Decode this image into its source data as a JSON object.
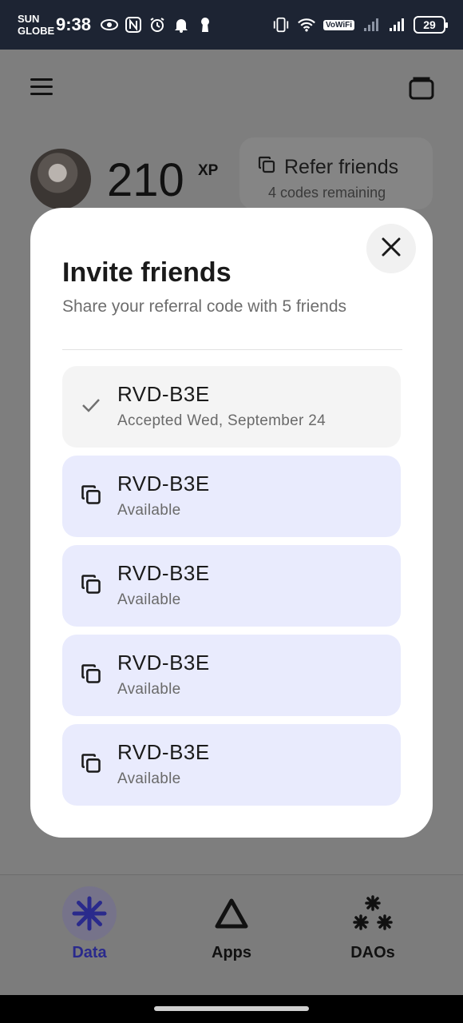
{
  "status_bar": {
    "carrier_line1": "SUN",
    "carrier_line2": "GLOBE",
    "time": "9:38",
    "vowifi": "VoWiFi",
    "battery": "29",
    "left_icons": [
      "eye-icon",
      "nfc-icon",
      "alarm-icon",
      "bell-icon",
      "keyhole-icon"
    ],
    "right_icons": [
      "vibrate-icon",
      "wifi-icon",
      "vowifi-badge",
      "signal-icon",
      "signal-icon",
      "battery-icon"
    ]
  },
  "header": {
    "menu_icon": "hamburger-menu-icon",
    "wallet_icon": "wallet-icon"
  },
  "profile": {
    "xp_value": "210",
    "xp_unit": "XP"
  },
  "refer_card": {
    "title": "Refer friends",
    "subtitle": "4 codes remaining",
    "icon": "copy-icon"
  },
  "modal": {
    "title": "Invite friends",
    "subtitle": "Share your referral code with 5 friends",
    "close_icon": "close-icon",
    "codes": [
      {
        "code": "RVD-B3E",
        "status": "Accepted Wed, September 24",
        "icon": "check-icon",
        "state": "accepted"
      },
      {
        "code": "RVD-B3E",
        "status": "Available",
        "icon": "copy-icon",
        "state": "available"
      },
      {
        "code": "RVD-B3E",
        "status": "Available",
        "icon": "copy-icon",
        "state": "available"
      },
      {
        "code": "RVD-B3E",
        "status": "Available",
        "icon": "copy-icon",
        "state": "available"
      },
      {
        "code": "RVD-B3E",
        "status": "Available",
        "icon": "copy-icon",
        "state": "available"
      }
    ]
  },
  "bottom_nav": {
    "items": [
      {
        "label": "Data",
        "icon": "asterisk-icon",
        "active": true
      },
      {
        "label": "Apps",
        "icon": "triangle-icon",
        "active": false
      },
      {
        "label": "DAOs",
        "icon": "stars-icon",
        "active": false
      }
    ]
  },
  "colors": {
    "accent": "#2a2a8c",
    "code_available_bg": "#e9ebfd",
    "code_accepted_bg": "#f4f4f4",
    "overlay": "#7e7e7e"
  }
}
